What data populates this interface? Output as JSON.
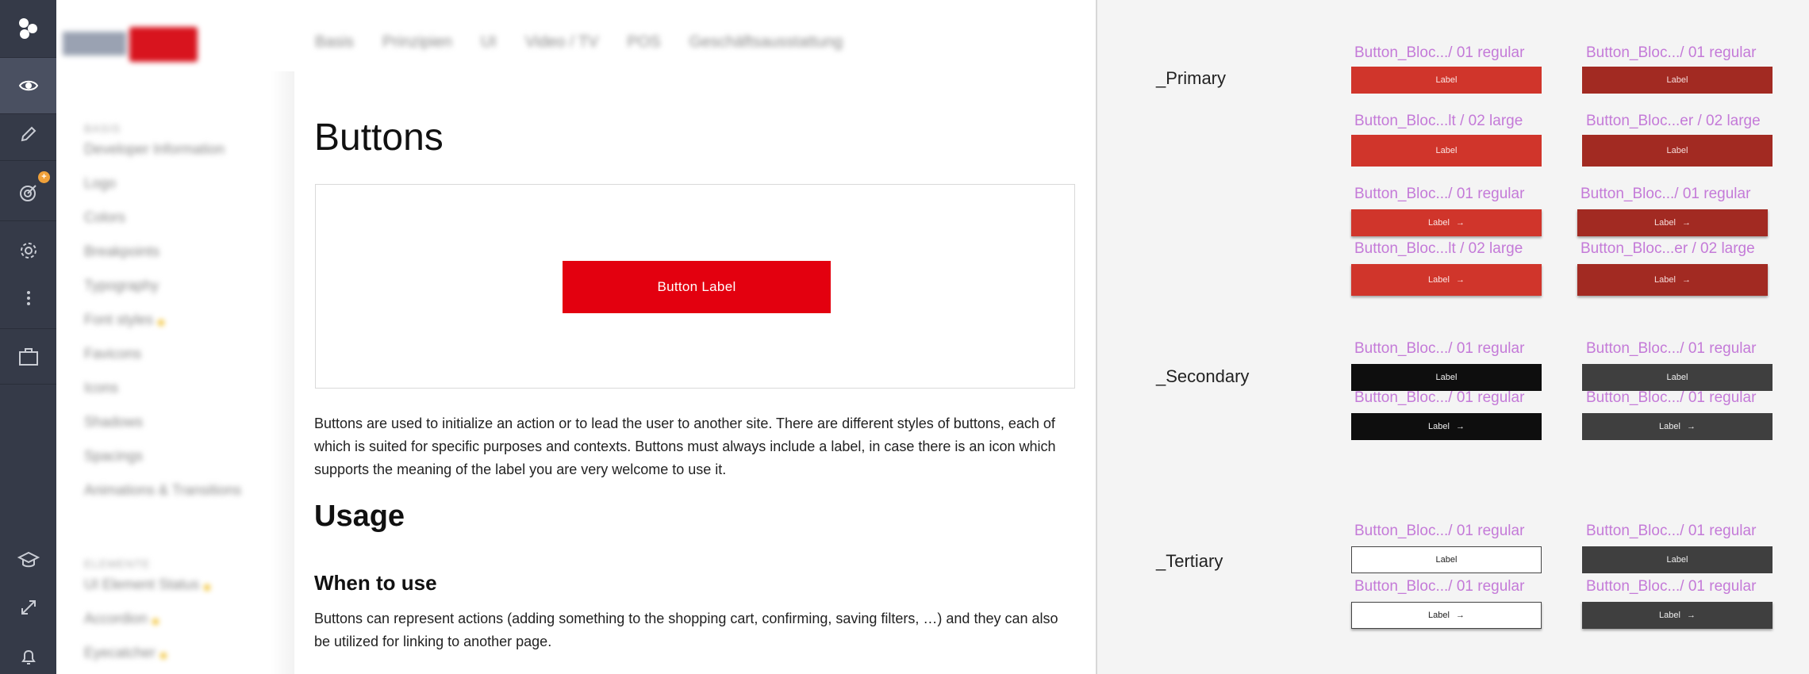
{
  "rail": {
    "logo": "app-logo-icon",
    "items": [
      {
        "icon": "eye-icon",
        "active": true
      },
      {
        "icon": "pencil-icon",
        "active": false
      },
      {
        "icon": "target-icon",
        "active": false,
        "badge": "+"
      },
      {
        "icon": "gear-icon",
        "active": false
      },
      {
        "icon": "more-dots-icon",
        "active": false
      },
      {
        "icon": "briefcase-icon",
        "active": false
      }
    ],
    "bottom_items": [
      {
        "icon": "graduation-cap-icon"
      },
      {
        "icon": "expand-icon"
      },
      {
        "icon": "bell-icon"
      }
    ],
    "colors": {
      "background": "#353a48",
      "active": "#4a5061",
      "badge": "#f0a13a"
    }
  },
  "doc": {
    "top_nav": [
      "Basis",
      "Prinzipien",
      "UI",
      "Video / TV",
      "POS",
      "Geschäftsausstattung"
    ],
    "sidebar": {
      "section1": "BASIS",
      "items1": [
        "Developer Information",
        "Logo",
        "Colors",
        "Breakpoints",
        "Typography",
        "Font styles",
        "Favicons",
        "Icons",
        "Shadows",
        "Spacings",
        "Animations & Transitions"
      ],
      "section2": "ELEMENTE",
      "items2": [
        "UI Element Status",
        "Accordion",
        "Eyecatcher"
      ]
    },
    "title": "Buttons",
    "example_button_label": "Button Label",
    "intro": "Buttons are used to initialize an action or to lead the user to another site. There are different styles of buttons, each of which is suited for specific purposes and contexts. Buttons must always include a label, in case there is an icon which supports the meaning of the label you are very welcome to use it.",
    "usage_heading": "Usage",
    "when_heading": "When to use",
    "when_text": "Buttons can represent actions (adding something to the shopping cart, confirming, saving filters, …) and they can also be utilized for linking to another page.",
    "colors": {
      "brand_red": "#e3000f"
    }
  },
  "canvas": {
    "primary": {
      "label": "_Primary",
      "names": [
        "Button_Bloc.../ 01 regular",
        "Button_Bloc.../ 01 regular",
        "Button_Bloc...lt / 02 large",
        "Button_Bloc...er / 02 large",
        "Button_Bloc.../ 01 regular",
        "Button_Bloc.../ 01 regular",
        "Button_Bloc...lt / 02 large",
        "Button_Bloc...er / 02 large"
      ],
      "button_label": "Label",
      "arrow": "→"
    },
    "secondary": {
      "label": "_Secondary",
      "names": [
        "Button_Bloc.../ 01 regular",
        "Button_Bloc.../ 01 regular",
        "Button_Bloc.../ 01 regular",
        "Button_Bloc.../ 01 regular"
      ],
      "button_label": "Label",
      "arrow": "→"
    },
    "tertiary": {
      "label": "_Tertiary",
      "names": [
        "Button_Bloc.../ 01 regular",
        "Button_Bloc.../ 01 regular",
        "Button_Bloc.../ 01 regular",
        "Button_Bloc.../ 01 regular"
      ],
      "button_label": "Label",
      "arrow": "→"
    },
    "colors": {
      "component_name": "#c47ad8",
      "primary_light": "#d0352b",
      "primary_dark": "#a22a22",
      "secondary_black": "#0e0e0e",
      "dark_grey": "#3f3f3f"
    }
  }
}
